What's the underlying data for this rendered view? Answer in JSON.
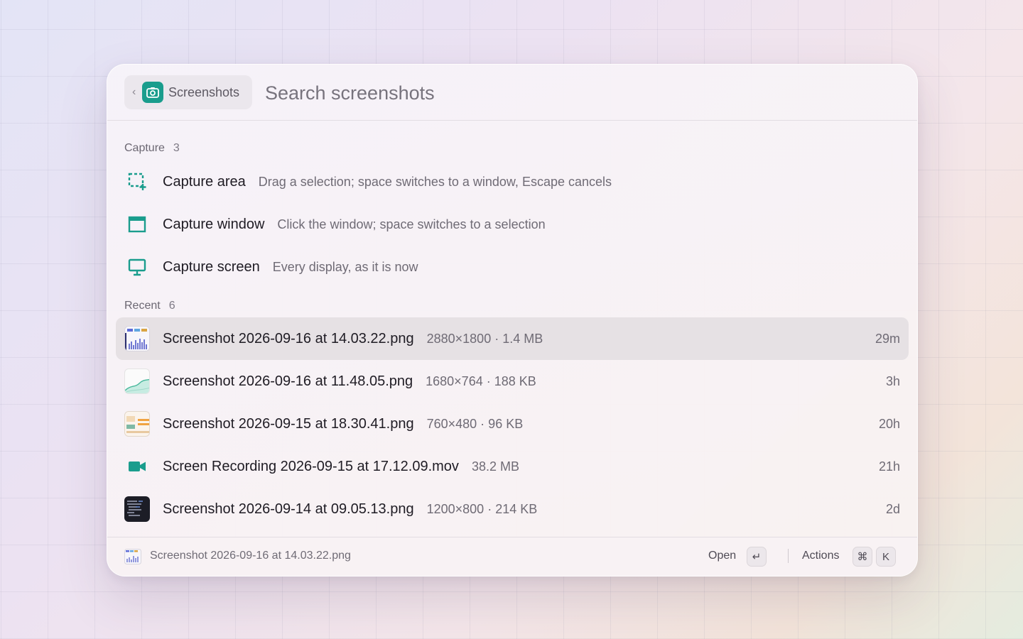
{
  "header": {
    "back_chevron": "‹",
    "breadcrumb_icon": "camera-icon",
    "breadcrumb_label": "Screenshots",
    "search_placeholder": "Search screenshots",
    "search_value": ""
  },
  "capture": {
    "label": "Capture",
    "count": "3",
    "items": [
      {
        "title": "Capture area",
        "subtitle": "Drag a selection; space switches to a window, Escape cancels",
        "icon": "capture-area-icon"
      },
      {
        "title": "Capture window",
        "subtitle": "Click the window; space switches to a selection",
        "icon": "capture-window-icon"
      },
      {
        "title": "Capture screen",
        "subtitle": "Every display, as it is now",
        "icon": "capture-screen-icon"
      }
    ]
  },
  "recent": {
    "label": "Recent",
    "count": "6",
    "items": [
      {
        "title": "Screenshot 2026-09-16 at 14.03.22.png",
        "meta": "2880×1800 · 1.4 MB",
        "age": "29m",
        "icon": "chart-thumbnail-icon",
        "selected": true
      },
      {
        "title": "Screenshot 2026-09-16 at 11.48.05.png",
        "meta": "1680×764 · 188 KB",
        "age": "3h",
        "icon": "area-chart-thumbnail-icon"
      },
      {
        "title": "Screenshot 2026-09-15 at 18.30.41.png",
        "meta": "760×480 · 96 KB",
        "age": "20h",
        "icon": "app-window-thumbnail-icon"
      },
      {
        "title": "Screen Recording 2026-09-15 at 17.12.09.mov",
        "meta": "38.2 MB",
        "age": "21h",
        "icon": "video-camera-icon"
      },
      {
        "title": "Screenshot 2026-09-14 at 09.05.13.png",
        "meta": "1200×800 · 214 KB",
        "age": "2d",
        "icon": "code-editor-thumbnail-icon"
      }
    ]
  },
  "footer": {
    "selected_name": "Screenshot 2026-09-16 at 14.03.22.png",
    "open_label": "Open",
    "open_key": "↵",
    "actions_label": "Actions",
    "actions_key_mod": "⌘",
    "actions_key": "K"
  },
  "colors": {
    "accent": "#1a9d8d",
    "selected_row": "#e6e1e4"
  }
}
